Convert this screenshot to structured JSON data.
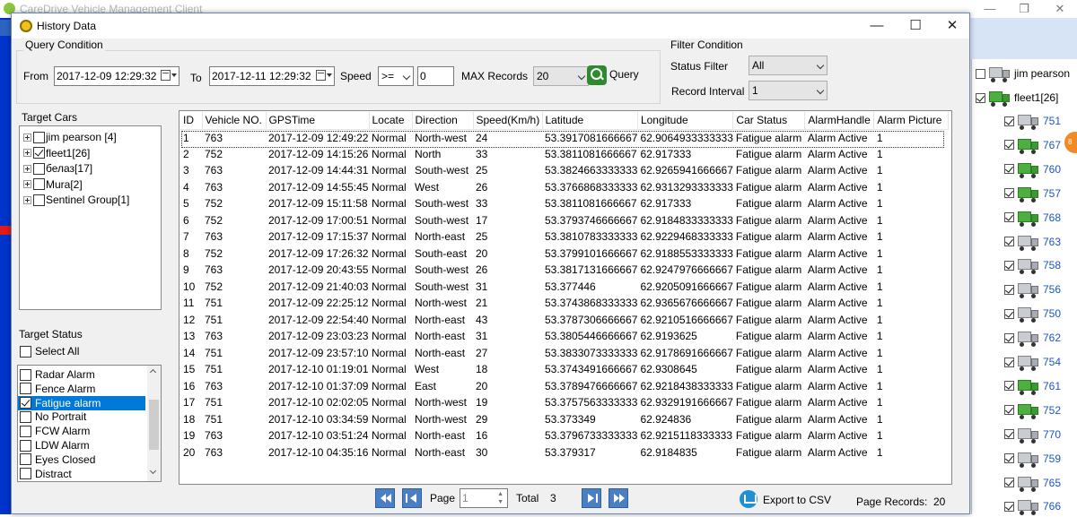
{
  "background": {
    "app_title": "CareDrive Vehicle Management Client",
    "tree_items": [
      {
        "label": "jim pearson",
        "checked": false
      },
      {
        "label": "fleet1[26]",
        "checked": true
      }
    ],
    "units": [
      "751",
      "767",
      "760",
      "757",
      "768",
      "763",
      "758",
      "756",
      "750",
      "762",
      "754",
      "761",
      "752",
      "770",
      "759",
      "765",
      "766"
    ]
  },
  "dialog": {
    "title": "History Data",
    "query_condition": {
      "group_label": "Query Condition",
      "from_label": "From",
      "from_value": "2017-12-09 12:29:32",
      "to_label": "To",
      "to_value": "2017-12-11 12:29:32",
      "speed_label": "Speed",
      "speed_operator": ">=",
      "speed_value": "0",
      "max_records_label": "MAX Records",
      "max_records_value": "20",
      "query_button": "Query"
    },
    "filter_condition": {
      "group_label": "Filter Condition",
      "status_filter_label": "Status Filter",
      "status_filter_value": "All",
      "record_interval_label": "Record Interval",
      "record_interval_value": "1"
    },
    "target_cars": {
      "label": "Target Cars",
      "items": [
        {
          "label": "jim pearson [4]",
          "checked": false
        },
        {
          "label": "fleet1[26]",
          "checked": true
        },
        {
          "label": "белаз[17]",
          "checked": false
        },
        {
          "label": "Mura[2]",
          "checked": false
        },
        {
          "label": "Sentinel Group[1]",
          "checked": false
        }
      ]
    },
    "target_status": {
      "label": "Target Status",
      "select_all": "Select All",
      "items": [
        {
          "label": "Radar Alarm",
          "checked": false
        },
        {
          "label": "Fence Alarm",
          "checked": false
        },
        {
          "label": "Fatigue alarm",
          "checked": true,
          "selected": true
        },
        {
          "label": "No Portrait",
          "checked": false
        },
        {
          "label": "FCW Alarm",
          "checked": false
        },
        {
          "label": "LDW Alarm",
          "checked": false
        },
        {
          "label": "Eyes Closed",
          "checked": false
        },
        {
          "label": "Distract",
          "checked": false
        }
      ]
    },
    "table": {
      "columns": [
        "ID",
        "Vehicle NO.",
        "GPSTime",
        "Locate",
        "Direction",
        "Speed(Km/h)",
        "Latitude",
        "Longitude",
        "Car Status",
        "AlarmHandle",
        "Alarm Picture"
      ],
      "rows": [
        [
          "1",
          "763",
          "2017-12-09 12:49:22",
          "Normal",
          "North-west",
          "24",
          "53.3917081666667",
          "62.9064933333333",
          "Fatigue alarm",
          "Alarm Active",
          "1"
        ],
        [
          "2",
          "752",
          "2017-12-09 14:15:26",
          "Normal",
          "North",
          "33",
          "53.3811081666667",
          "62.917333",
          "Fatigue alarm",
          "Alarm Active",
          "1"
        ],
        [
          "3",
          "763",
          "2017-12-09 14:44:31",
          "Normal",
          "South-west",
          "25",
          "53.3824663333333",
          "62.9265941666667",
          "Fatigue alarm",
          "Alarm Active",
          "1"
        ],
        [
          "4",
          "763",
          "2017-12-09 14:55:45",
          "Normal",
          "West",
          "26",
          "53.3766868333333",
          "62.9313293333333",
          "Fatigue alarm",
          "Alarm Active",
          "1"
        ],
        [
          "5",
          "752",
          "2017-12-09 15:11:58",
          "Normal",
          "South-west",
          "33",
          "53.3811081666667",
          "62.917333",
          "Fatigue alarm",
          "Alarm Active",
          "1"
        ],
        [
          "6",
          "752",
          "2017-12-09 17:00:51",
          "Normal",
          "South-west",
          "17",
          "53.3793746666667",
          "62.9184833333333",
          "Fatigue alarm",
          "Alarm Active",
          "1"
        ],
        [
          "7",
          "763",
          "2017-12-09 17:15:37",
          "Normal",
          "North-east",
          "25",
          "53.3810783333333",
          "62.9229468333333",
          "Fatigue alarm",
          "Alarm Active",
          "1"
        ],
        [
          "8",
          "752",
          "2017-12-09 17:26:32",
          "Normal",
          "South-east",
          "20",
          "53.3799101666667",
          "62.9188553333333",
          "Fatigue alarm",
          "Alarm Active",
          "1"
        ],
        [
          "9",
          "763",
          "2017-12-09 20:43:55",
          "Normal",
          "South-west",
          "26",
          "53.3817131666667",
          "62.9247976666667",
          "Fatigue alarm",
          "Alarm Active",
          "1"
        ],
        [
          "10",
          "752",
          "2017-12-09 21:40:03",
          "Normal",
          "South-west",
          "31",
          "53.377446",
          "62.9205091666667",
          "Fatigue alarm",
          "Alarm Active",
          "1"
        ],
        [
          "11",
          "751",
          "2017-12-09 22:25:12",
          "Normal",
          "North-west",
          "21",
          "53.3743868333333",
          "62.9365676666667",
          "Fatigue alarm",
          "Alarm Active",
          "1"
        ],
        [
          "12",
          "751",
          "2017-12-09 22:54:40",
          "Normal",
          "North-east",
          "43",
          "53.3787306666667",
          "62.9210516666667",
          "Fatigue alarm",
          "Alarm Active",
          "1"
        ],
        [
          "13",
          "763",
          "2017-12-09 23:03:23",
          "Normal",
          "North-east",
          "31",
          "53.3805446666667",
          "62.9193625",
          "Fatigue alarm",
          "Alarm Active",
          "1"
        ],
        [
          "14",
          "751",
          "2017-12-09 23:57:10",
          "Normal",
          "North-east",
          "27",
          "53.3833073333333",
          "62.9178691666667",
          "Fatigue alarm",
          "Alarm Active",
          "1"
        ],
        [
          "15",
          "751",
          "2017-12-10 01:19:01",
          "Normal",
          "West",
          "18",
          "53.3743491666667",
          "62.9308645",
          "Fatigue alarm",
          "Alarm Active",
          "1"
        ],
        [
          "16",
          "763",
          "2017-12-10 01:37:09",
          "Normal",
          "East",
          "20",
          "53.3789476666667",
          "62.9218438333333",
          "Fatigue alarm",
          "Alarm Active",
          "1"
        ],
        [
          "17",
          "751",
          "2017-12-10 02:02:05",
          "Normal",
          "North-west",
          "19",
          "53.3757563333333",
          "62.9329191666667",
          "Fatigue alarm",
          "Alarm Active",
          "1"
        ],
        [
          "18",
          "751",
          "2017-12-10 03:34:59",
          "Normal",
          "North-west",
          "29",
          "53.373349",
          "62.924836",
          "Fatigue alarm",
          "Alarm Active",
          "1"
        ],
        [
          "19",
          "763",
          "2017-12-10 03:51:24",
          "Normal",
          "North-east",
          "16",
          "53.3796733333333",
          "62.9215118333333",
          "Fatigue alarm",
          "Alarm Active",
          "1"
        ],
        [
          "20",
          "763",
          "2017-12-10 04:35:16",
          "Normal",
          "North-east",
          "30",
          "53.379317",
          "62.9184835",
          "Fatigue alarm",
          "Alarm Active",
          "1"
        ]
      ]
    },
    "pager": {
      "page_label": "Page",
      "page_value": "1",
      "total_label": "Total",
      "total_value": "3",
      "export_label": "Export to CSV",
      "page_records_label": "Page Records:",
      "page_records_value": "20"
    }
  }
}
